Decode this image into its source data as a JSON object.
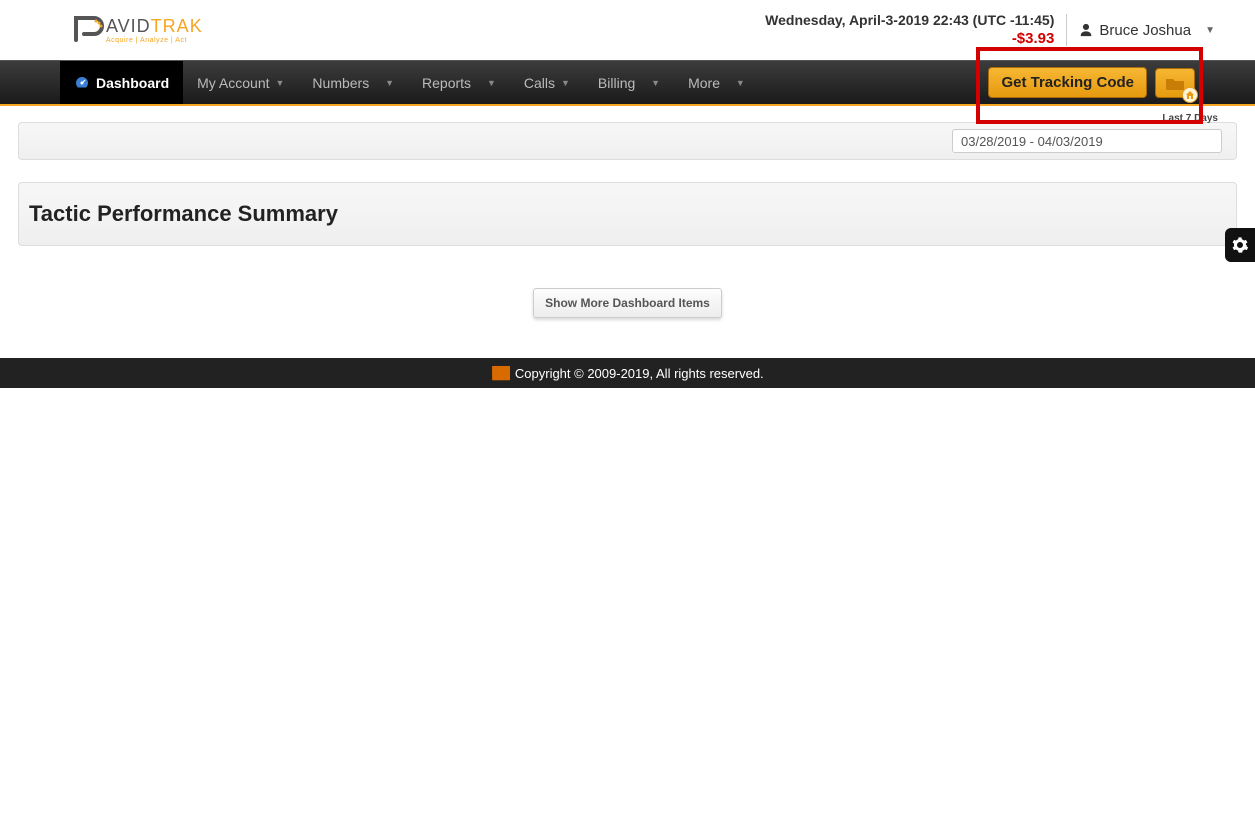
{
  "logo": {
    "brand1": "AVID",
    "brand2": "TRAK",
    "tagline": "Acquire | Analyze | Act"
  },
  "header": {
    "datetime": "Wednesday, April-3-2019 22:43 (UTC -11:45)",
    "balance": "-$3.93",
    "user_name": "Bruce Joshua"
  },
  "nav": {
    "items": [
      "Dashboard",
      "My Account",
      "Numbers",
      "Reports",
      "Calls",
      "Billing",
      "More"
    ],
    "tracking_label": "Get Tracking Code"
  },
  "daterange": {
    "label": "Last 7 Days",
    "value": "03/28/2019 - 04/03/2019"
  },
  "summary_title": "Tactic Performance Summary",
  "show_more_label": "Show More Dashboard Items",
  "footer": "Copyright © 2009-2019, All rights reserved."
}
